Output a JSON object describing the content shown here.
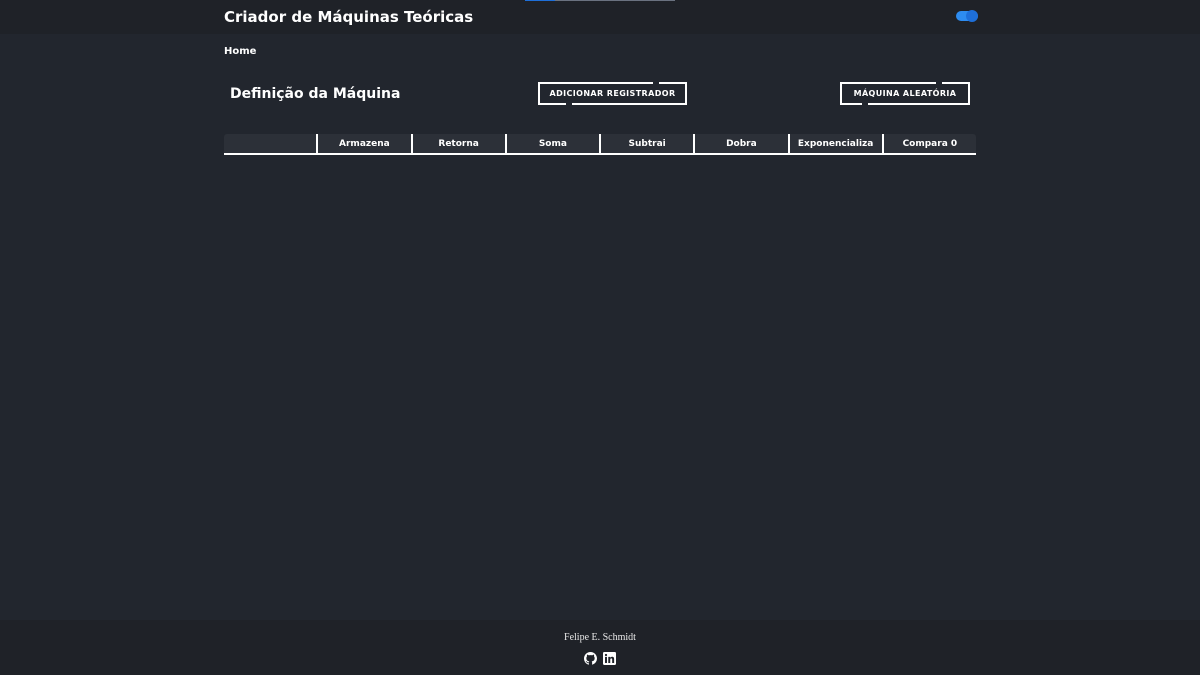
{
  "header": {
    "title": "Criador de Máquinas Teóricas",
    "theme_toggle": {
      "state": "on",
      "color": "#2d8cf0"
    }
  },
  "breadcrumb": {
    "home": "Home"
  },
  "machine": {
    "title": "Definição da Máquina",
    "add_register_label": "ADICIONAR REGISTRADOR",
    "random_machine_label": "MÁQUINA ALEATÓRIA"
  },
  "table": {
    "columns": [
      "",
      "Armazena",
      "Retorna",
      "Soma",
      "Subtrai",
      "Dobra",
      "Exponencializa",
      "Compara 0"
    ]
  },
  "footer": {
    "author": "Felipe E. Schmidt",
    "links": [
      {
        "icon": "github-icon"
      },
      {
        "icon": "linkedin-icon"
      }
    ]
  },
  "colors": {
    "background": "#22262e",
    "bar": "#1f2228",
    "accent": "#1e6fd9",
    "text": "#ffffff"
  }
}
